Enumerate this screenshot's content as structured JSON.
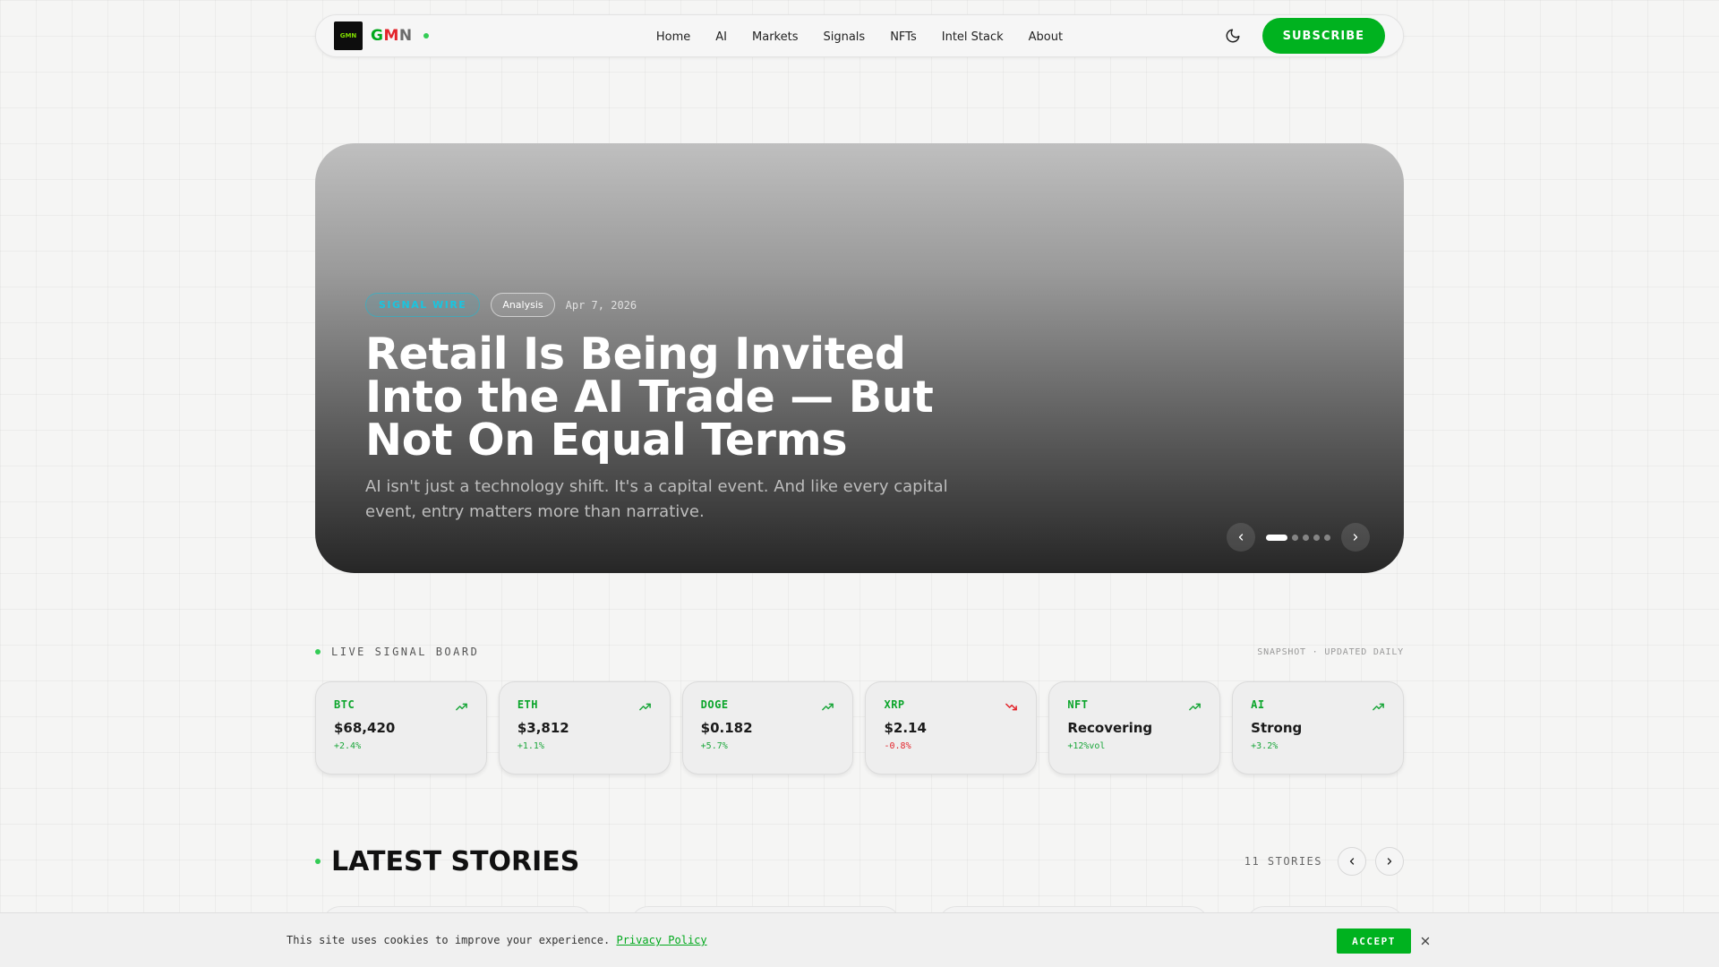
{
  "nav": {
    "logo_text": "GMN",
    "brand": {
      "g": "G",
      "m": "M",
      "n": "N"
    },
    "links": [
      "Home",
      "AI",
      "Markets",
      "Signals",
      "NFTs",
      "Intel Stack",
      "About"
    ],
    "theme_icon": "moon-icon",
    "subscribe_label": "SUBSCRIBE"
  },
  "hero": {
    "tag_primary": "SIGNAL WIRE",
    "tag_secondary": "Analysis",
    "date": "Apr 7, 2026",
    "title": "Retail Is Being Invited Into the AI Trade — But Not On Equal Terms",
    "subtitle": "AI isn't just a technology shift. It's a capital event. And like every capital event, entry matters more than narrative.",
    "slides_total": 5,
    "active_slide": 1
  },
  "signal_board": {
    "title": "LIVE SIGNAL BOARD",
    "note": "SNAPSHOT · UPDATED DAILY",
    "cards": [
      {
        "symbol": "BTC",
        "value": "$68,420",
        "change": "+2.4%",
        "direction": "up"
      },
      {
        "symbol": "ETH",
        "value": "$3,812",
        "change": "+1.1%",
        "direction": "up"
      },
      {
        "symbol": "DOGE",
        "value": "$0.182",
        "change": "+5.7%",
        "direction": "up"
      },
      {
        "symbol": "XRP",
        "value": "$2.14",
        "change": "-0.8%",
        "direction": "down"
      },
      {
        "symbol": "NFT",
        "value": "Recovering",
        "change": "+12%vol",
        "direction": "up"
      },
      {
        "symbol": "AI",
        "value": "Strong",
        "change": "+3.2%",
        "direction": "up"
      }
    ]
  },
  "latest": {
    "title": "LATEST STORIES",
    "count": "11 STORIES"
  },
  "cookie": {
    "text": "This site uses cookies to improve your experience.",
    "link": "Privacy Policy",
    "accept_label": "ACCEPT"
  },
  "colors": {
    "accent": "#00b21f",
    "positive": "#1aa63a",
    "negative": "#e3242b",
    "wire": "#19c5e0"
  }
}
